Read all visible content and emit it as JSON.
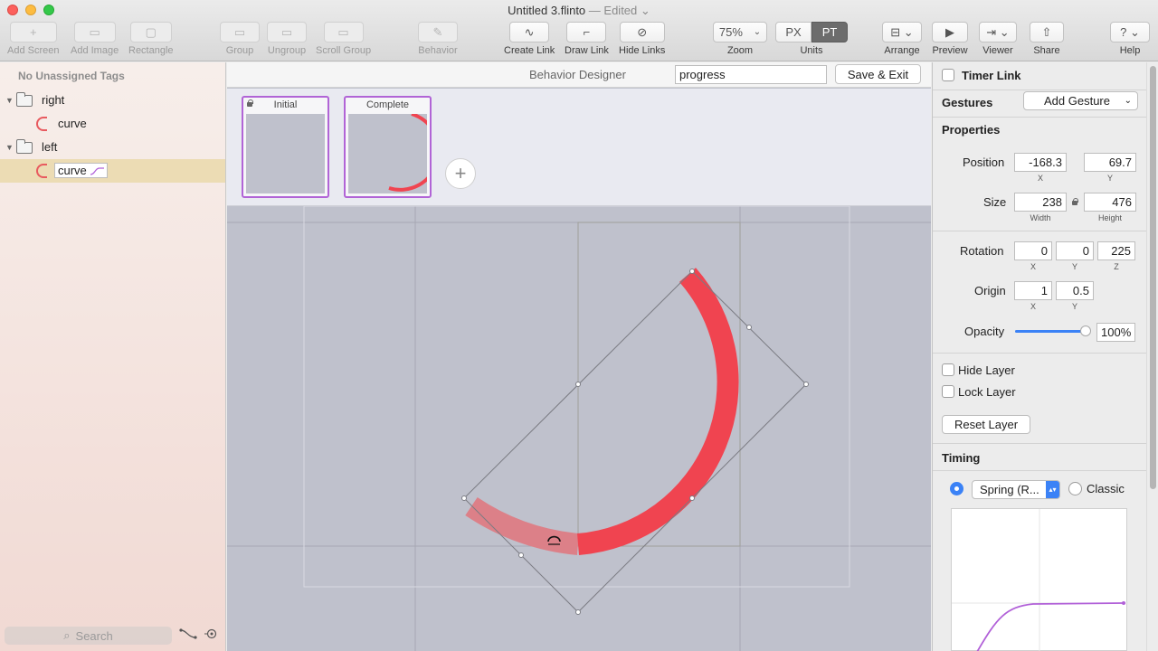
{
  "window": {
    "title": "Untitled 3.flinto",
    "edited": "— Edited",
    "traffic_colors": [
      "#fc605c",
      "#fdbc40",
      "#34c84a"
    ]
  },
  "toolbar": {
    "add_screen": "Add Screen",
    "add_image": "Add Image",
    "rectangle": "Rectangle",
    "group": "Group",
    "ungroup": "Ungroup",
    "scroll_group": "Scroll Group",
    "behavior": "Behavior",
    "create_link": "Create Link",
    "draw_link": "Draw Link",
    "hide_links": "Hide Links",
    "zoom_value": "75%",
    "zoom_label": "Zoom",
    "units_px": "PX",
    "units_pt": "PT",
    "units_label": "Units",
    "arrange": "Arrange",
    "preview": "Preview",
    "viewer": "Viewer",
    "share": "Share",
    "help": "Help"
  },
  "sidebar": {
    "unassigned": "No Unassigned Tags",
    "tree": [
      {
        "label": "right",
        "type": "folder"
      },
      {
        "label": "curve",
        "type": "layer"
      },
      {
        "label": "left",
        "type": "folder"
      },
      {
        "label": "curve",
        "type": "layer",
        "selected": true
      }
    ],
    "search_placeholder": "Search"
  },
  "behavior_designer": {
    "title": "Behavior Designer",
    "name_value": "progress",
    "save_exit": "Save & Exit",
    "states": [
      "Initial",
      "Complete"
    ]
  },
  "inspector": {
    "timer_link": "Timer Link",
    "gestures": "Gestures",
    "add_gesture": "Add Gesture",
    "properties": "Properties",
    "position_label": "Position",
    "position_x": "-168.3",
    "position_y": "69.7",
    "x_label": "X",
    "y_label": "Y",
    "z_label": "Z",
    "size_label": "Size",
    "width": "238",
    "height": "476",
    "width_label": "Width",
    "height_label": "Height",
    "rotation_label": "Rotation",
    "rotation_x": "0",
    "rotation_y": "0",
    "rotation_z": "225",
    "origin_label": "Origin",
    "origin_x": "1",
    "origin_y": "0.5",
    "opacity_label": "Opacity",
    "opacity_value": "100%",
    "opacity_fraction": 1.0,
    "hide_layer": "Hide Layer",
    "lock_layer": "Lock Layer",
    "reset_layer": "Reset Layer",
    "timing": "Timing",
    "spring_option": "Spring (R...",
    "classic_option": "Classic"
  },
  "colors": {
    "accent": "#3b82f6",
    "curve_red": "#f04450",
    "state_border": "#b164d6",
    "spring_curve": "#b160d8"
  }
}
